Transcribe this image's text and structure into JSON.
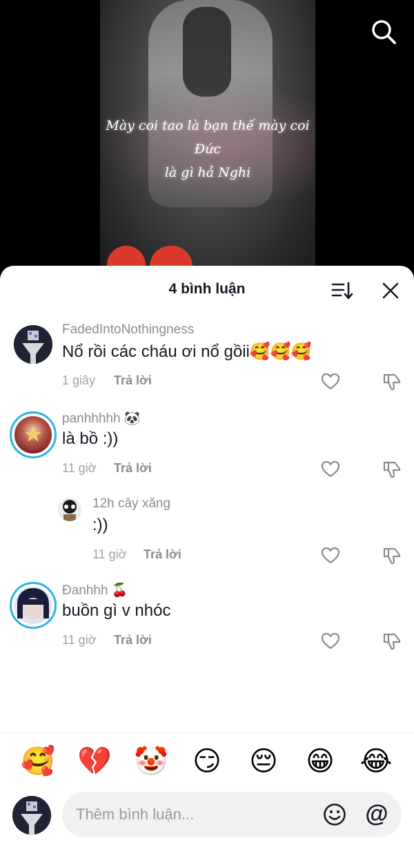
{
  "video": {
    "caption_line1": "Mày coi tao là bạn thế mày coi Đức",
    "caption_line2": "là gì hả Nghi"
  },
  "sheet": {
    "title": "4 bình luận"
  },
  "comments": [
    {
      "username": "FadedIntoNothingness",
      "text": "Nổ rồi các cháu ơi nổ gồii🥰🥰🥰",
      "time": "1 giây",
      "reply_label": "Trả lời"
    },
    {
      "username": "panhhhhh 🐼",
      "text": "là bồ :))",
      "time": "11 giờ",
      "reply_label": "Trả lời"
    },
    {
      "username": "12h cây xăng",
      "text": ":))",
      "time": "11 giờ",
      "reply_label": "Trả lời"
    },
    {
      "username": "Đanhhh 🍒",
      "text": "buồn gì v nhóc",
      "time": "11 giờ",
      "reply_label": "Trả lời"
    }
  ],
  "quick_emojis": [
    "🥰",
    "💔",
    "🤡",
    "😏",
    "😔",
    "😁",
    "😂"
  ],
  "composer": {
    "placeholder": "Thêm bình luận...",
    "mention_symbol": "@"
  },
  "colors": {
    "accent_ring": "#2bb6e3",
    "text_primary": "#161823",
    "text_secondary": "#8a8b91"
  },
  "icons": [
    "search-icon",
    "sort-icon",
    "close-icon",
    "heart-icon",
    "dislike-icon",
    "emoji-face-icon",
    "mention-icon"
  ]
}
